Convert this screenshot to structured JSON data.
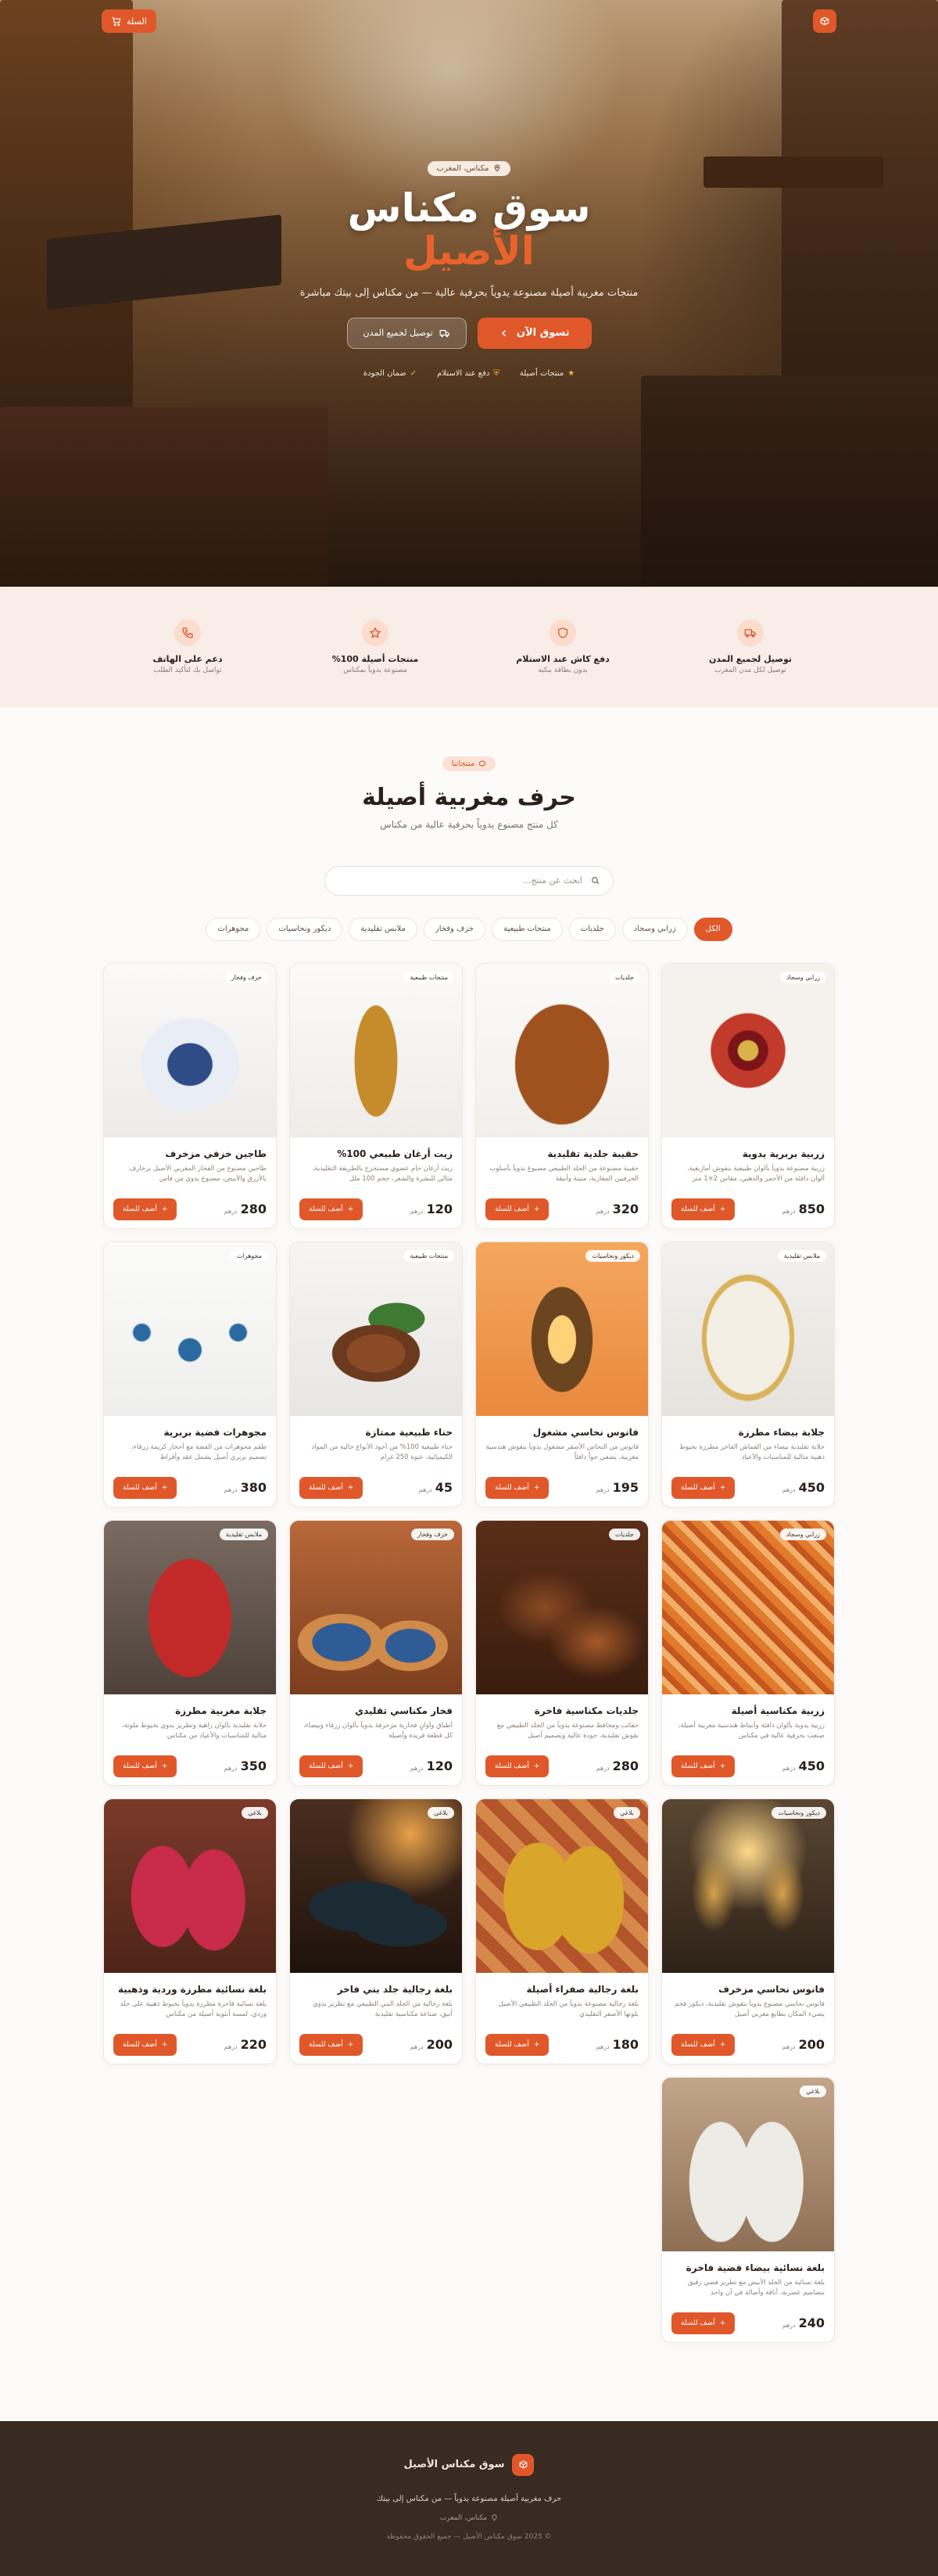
{
  "header": {
    "cart_label": "السلة"
  },
  "hero": {
    "location_badge": "مكناس، المغرب",
    "title_line1": "سوق مكناس",
    "title_line2": "الأصيل",
    "subtitle": "منتجات مغربية أصيلة مصنوعة يدوياً بحرفية عالية — من مكناس إلى بيتك مباشرة",
    "cta_primary": "تسوق الآن",
    "cta_secondary": "توصيل لجميع المدن",
    "badges": [
      "منتجات أصيلة",
      "دفع عند الاستلام",
      "ضمان الجودة"
    ]
  },
  "features": [
    {
      "title": "توصيل لجميع المدن",
      "desc": "توصيل لكل مدن المغرب",
      "icon": "truck-icon"
    },
    {
      "title": "دفع كاش عند الاستلام",
      "desc": "بدون بطاقة بنكية",
      "icon": "shield-icon"
    },
    {
      "title": "منتجات أصيلة 100%",
      "desc": "مصنوعة يدوياً بمكناس",
      "icon": "star-icon"
    },
    {
      "title": "دعم على الهاتف",
      "desc": "تواصل بك لتأكيد الطلب",
      "icon": "phone-icon"
    }
  ],
  "shop": {
    "eyebrow": "منتجاتنا",
    "title": "حرف مغربية أصيلة",
    "subtitle": "كل منتج مصنوع يدوياً بحرفية عالية من مكناس",
    "search_placeholder": "ابحث عن منتج...",
    "filters": [
      "الكل",
      "زرابي وسجاد",
      "جلديات",
      "منتجات طبيعية",
      "خزف وفخار",
      "ملابس تقليدية",
      "ديكور ونحاسيات",
      "مجوهرات"
    ],
    "active_filter": "الكل",
    "add_label": "أضف للسلة",
    "currency": "درهم"
  },
  "products": [
    {
      "name": "زربية بربرية يدوية",
      "category": "زرابي وسجاد",
      "desc": "زربية مصنوعة يدوياً بألوان طبيعية بنقوش أمازيغية، ألوان دافئة من الأحمر والذهبي، مقاس 2×1 متر",
      "price": "850",
      "img": "rug"
    },
    {
      "name": "حقيبة جلدية تقليدية",
      "category": "جلديات",
      "desc": "حقيبة مصنوعة من الجلد الطبيعي مصبوغ يدوياً بأسلوب الحرفيين المغاربة، متينة وأنيقة",
      "price": "320",
      "img": "bag"
    },
    {
      "name": "زيت أرغان طبيعي 100%",
      "category": "منتجات طبيعية",
      "desc": "زيت أرغان خام عضوي مستخرج بالطريقة التقليدية، مثالي للبشرة والشعر، حجم 100 ملل",
      "price": "120",
      "img": "argan"
    },
    {
      "name": "طاجين خزفي مزخرف",
      "category": "خزف وفخار",
      "desc": "طاجين مصنوع من الفخار المغربي الأصيل بزخارف بالأزرق والأبيض، مصنوع يدوي من فاس",
      "price": "280",
      "img": "tajine"
    },
    {
      "name": "جلابة بيضاء مطرزة",
      "category": "ملابس تقليدية",
      "desc": "جلابة تقليدية بيضاء من القماش الفاخر مطرزة بخيوط ذهبية مثالية للمناسبات والأعياد",
      "price": "450",
      "img": "djellaba-white"
    },
    {
      "name": "فانوس نحاسي مشغول",
      "category": "ديكور ونحاسيات",
      "desc": "فانوس من النحاس الأصفر مشغول يدوياً بنقوش هندسية مغربية، يضفي جواً دافئاً",
      "price": "195",
      "img": "lantern"
    },
    {
      "name": "حناء طبيعية ممتازة",
      "category": "منتجات طبيعية",
      "desc": "حناء طبيعية 100% من أجود الأنواع خالية من المواد الكيميائية، عبوة 250 غرام",
      "price": "45",
      "img": "henna"
    },
    {
      "name": "مجوهرات فضية بربرية",
      "category": "مجوهرات",
      "desc": "طقم مجوهرات من الفضة مع أحجار كريمة زرقاء، تصميم بربري أصيل يشمل عقد وأقراط",
      "price": "380",
      "img": "jewelry"
    },
    {
      "name": "زربية مكناسية أصيلة",
      "category": "زرابي وسجاد",
      "desc": "زربية يدوية بألوان دافئة وأنماط هندسية مغربية أصيلة، صنعت بحرفية عالية في مكناس",
      "price": "450",
      "img": "rug2"
    },
    {
      "name": "جلديات مكناسية فاخرة",
      "category": "جلديات",
      "desc": "حقائب ومحافظ مصنوعة يدوياً من الجلد الطبيعي مع نقوش تقليدية، جودة عالية وتصميم أصيل",
      "price": "280",
      "img": "leather"
    },
    {
      "name": "فخار مكناسي تقليدي",
      "category": "خزف وفخار",
      "desc": "أطباق وأوانٍ فخارية مزخرفة يدوياً بألوان زرقاء وبيضاء، كل قطعة فريدة وأصيلة",
      "price": "120",
      "img": "pottery"
    },
    {
      "name": "جلابة مغربية مطرزة",
      "category": "ملابس تقليدية",
      "desc": "جلابة تقليدية بألوان زاهية وتطريز يدوي بخيوط ملونة، مثالية للمناسبات والأعياد من مكناس",
      "price": "350",
      "img": "djellaba-red"
    },
    {
      "name": "فانوس نحاسي مزخرف",
      "category": "ديكور ونحاسيات",
      "desc": "فانوس نحاسي مصنوع يدوياً بنقوش تقليدية، ديكور فخم يضيء المكان بطابع مغربي أصيل",
      "price": "200",
      "img": "brass"
    },
    {
      "name": "بلغة رجالية صفراء أصيلة",
      "category": "بلاغي",
      "desc": "بلغة رجالية مصنوعة يدوياً من الجلد الطبيعي الأصيل بلونها الأصفر التقليدي",
      "price": "180",
      "img": "babouche-yellow"
    },
    {
      "name": "بلغة رجالية جلد بني فاخر",
      "category": "بلاغي",
      "desc": "بلغة رجالية من الجلد البني الطبيعي مع تطريز يدوي أنيق، صناعة مكناسية تقليدية",
      "price": "200",
      "img": "babouche-dark"
    },
    {
      "name": "بلغة نسائية مطرزة وردية وذهبية",
      "category": "بلاغي",
      "desc": "بلغة نسائية فاخرة مطرزة يدوياً بخيوط ذهبية على جلد وردي، لمسة أنثوية أصيلة من مكناس",
      "price": "220",
      "img": "babouche-pink"
    },
    {
      "name": "بلغة نسائية بيضاء فضية فاخرة",
      "category": "بلاغي",
      "desc": "بلغة نسائية من الجلد الأبيض مع تطريز فضي رقيق بتصاميم عصرية، أناقة وأصالة في آن واحد",
      "price": "240",
      "img": "babouche-white"
    }
  ],
  "footer": {
    "brand": "سوق مكناس الأصيل",
    "desc": "حرف مغربية أصيلة مصنوعة يدوياً — من مكناس إلى بيتك",
    "location": "مكناس، المغرب",
    "copyright": "© 2025 سوق مكناس الأصيل — جميع الحقوق محفوظة"
  },
  "colors": {
    "accent": "#e0582a",
    "footer_bg": "#3a2b22",
    "feature_bg": "#f8ede7"
  }
}
